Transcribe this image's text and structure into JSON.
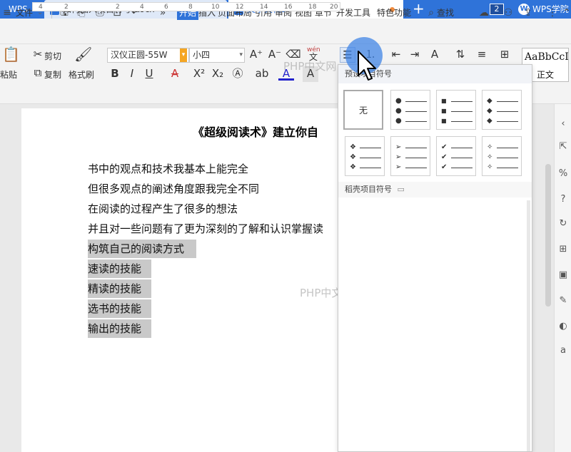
{
  "titlebar": {
    "app_tab": "WPS",
    "tabs": [
      {
        "label": "如何插入项目符号.docx",
        "close": "×"
      },
      {
        "label": "文字文稿3"
      }
    ],
    "new_tab": "+",
    "window_count": "2",
    "account_label": "WPS学院"
  },
  "menubar": {
    "menu_icon": "≡",
    "file_label": "文件",
    "items": [
      "开始",
      "插入",
      "页面布局",
      "引用",
      "审阅",
      "视图",
      "章节",
      "开发工具",
      "特色功能"
    ],
    "search_label": "查找"
  },
  "toolbar": {
    "paste_label": "粘贴",
    "cut_label": "剪切",
    "copy_label": "复制",
    "format_painter_label": "格式刷",
    "font_name": "汉仪正圆-55W",
    "font_size": "小四",
    "phonetic_label": "wén",
    "style_preview": "AaBbCcI",
    "style_name": "正文"
  },
  "ruler": {
    "numbers": [
      "4",
      "2",
      "2",
      "4",
      "6",
      "8",
      "10",
      "12",
      "14",
      "16",
      "18",
      "20",
      "22"
    ]
  },
  "document": {
    "title": "《超级阅读术》建立你自",
    "lines": [
      "书中的观点和技术我基本上能完全",
      "但很多观点的阐述角度跟我完全不同",
      "在阅读的过程产生了很多的想法",
      "并且对一些问题有了更为深刻的了解和认识掌握读",
      "构筑自己的阅读方式",
      "速读的技能",
      "精读的技能",
      "选书的技能",
      "输出的技能"
    ]
  },
  "bullet_dropdown": {
    "preset_header": "预设项目符号",
    "none_label": "无",
    "dao_ke_header": "稻壳项目符号",
    "presets": [
      {
        "symbol": "●",
        "name": "filled-circle"
      },
      {
        "symbol": "■",
        "name": "filled-square"
      },
      {
        "symbol": "◆",
        "name": "filled-diamond"
      },
      {
        "symbol": "❖",
        "name": "four-diamond"
      },
      {
        "symbol": "➢",
        "name": "arrowhead"
      },
      {
        "symbol": "✔",
        "name": "checkmark"
      },
      {
        "symbol": "✧",
        "name": "star-sparkle"
      }
    ]
  },
  "watermark": "PHP中文网"
}
